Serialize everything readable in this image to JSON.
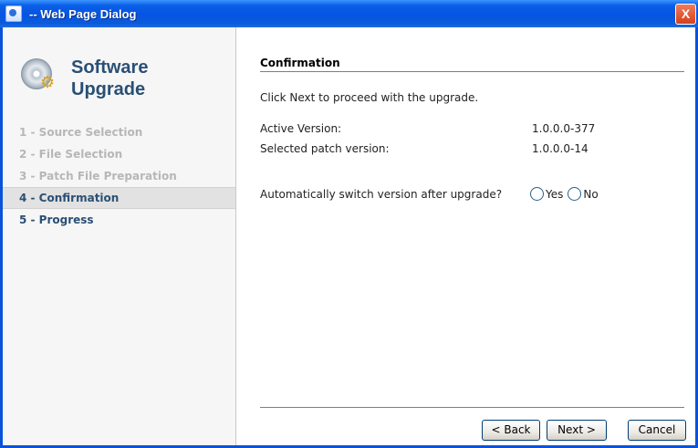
{
  "window": {
    "title": "-- Web Page Dialog",
    "close_label": "X"
  },
  "sidebar": {
    "title": "Software Upgrade",
    "steps": [
      {
        "label": "1 - Source Selection"
      },
      {
        "label": "2 - File Selection"
      },
      {
        "label": "3 - Patch File Preparation"
      },
      {
        "label": "4 - Confirmation"
      },
      {
        "label": "5 - Progress"
      }
    ]
  },
  "main": {
    "section_title": "Confirmation",
    "intro": "Click Next to proceed with the upgrade.",
    "active_version_label": "Active Version:",
    "active_version_value": "1.0.0.0-377",
    "patch_version_label": "Selected patch version:",
    "patch_version_value": "1.0.0.0-14",
    "switch_question": "Automatically switch version after upgrade?",
    "option_yes": "Yes",
    "option_no": "No"
  },
  "buttons": {
    "back": "< Back",
    "next": "Next >",
    "cancel": "Cancel"
  },
  "colors": {
    "title_bar": "#0554E3",
    "accent_text": "#2A4F74",
    "disabled_text": "#B7B7B7"
  }
}
